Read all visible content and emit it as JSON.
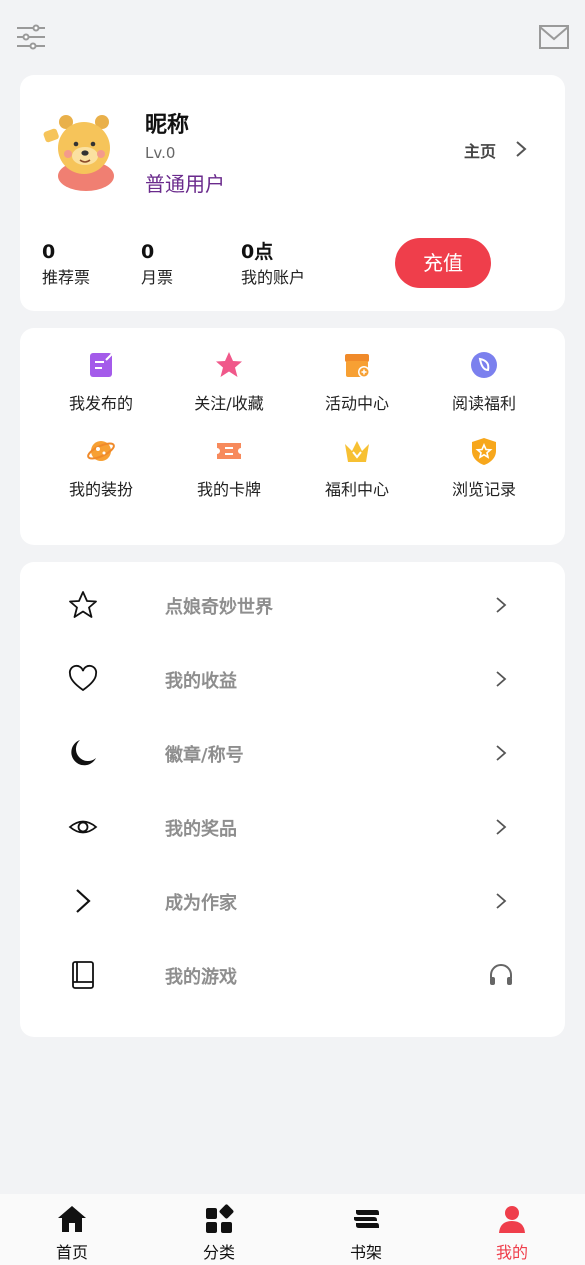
{
  "header": {
    "left_icon": "sliders-icon",
    "right_icon": "mail-icon"
  },
  "profile": {
    "nickname": "昵称",
    "level": "Lv.0",
    "user_type": "普通用户",
    "homepage_label": "主页",
    "stats": [
      {
        "value": "0",
        "label": "推荐票"
      },
      {
        "value": "0",
        "label": "月票"
      },
      {
        "value": "0点",
        "label": "我的账户"
      }
    ],
    "recharge_label": "充值"
  },
  "grid": {
    "items": [
      {
        "label": "我发布的",
        "icon": "edit-note-icon",
        "color": "#a45bea"
      },
      {
        "label": "关注/收藏",
        "icon": "star-icon",
        "color": "#f0588a"
      },
      {
        "label": "活动中心",
        "icon": "shop-icon",
        "color": "#f7a033"
      },
      {
        "label": "阅读福利",
        "icon": "leaf-icon",
        "color": "#7b80ee"
      },
      {
        "label": "我的装扮",
        "icon": "planet-icon",
        "color": "#f7a033"
      },
      {
        "label": "我的卡牌",
        "icon": "ticket-icon",
        "color": "#f78a5c"
      },
      {
        "label": "福利中心",
        "icon": "crown-icon",
        "color": "#f7c033"
      },
      {
        "label": "浏览记录",
        "icon": "shield-star-icon",
        "color": "#f7a71c"
      }
    ]
  },
  "menu": {
    "items": [
      {
        "label": "点娘奇妙世界",
        "icon": "star-outline-icon"
      },
      {
        "label": "我的收益",
        "icon": "heart-outline-icon"
      },
      {
        "label": "徽章/称号",
        "icon": "moon-icon"
      },
      {
        "label": "我的奖品",
        "icon": "eye-icon"
      },
      {
        "label": "成为作家",
        "icon": "chevron-right-icon"
      },
      {
        "label": "我的游戏",
        "icon": "book-icon"
      }
    ]
  },
  "tabbar": {
    "tabs": [
      {
        "label": "首页",
        "icon": "home-icon"
      },
      {
        "label": "分类",
        "icon": "category-icon"
      },
      {
        "label": "书架",
        "icon": "bookshelf-icon"
      },
      {
        "label": "我的",
        "icon": "user-icon"
      }
    ],
    "active_color": "#ef3e4b"
  }
}
